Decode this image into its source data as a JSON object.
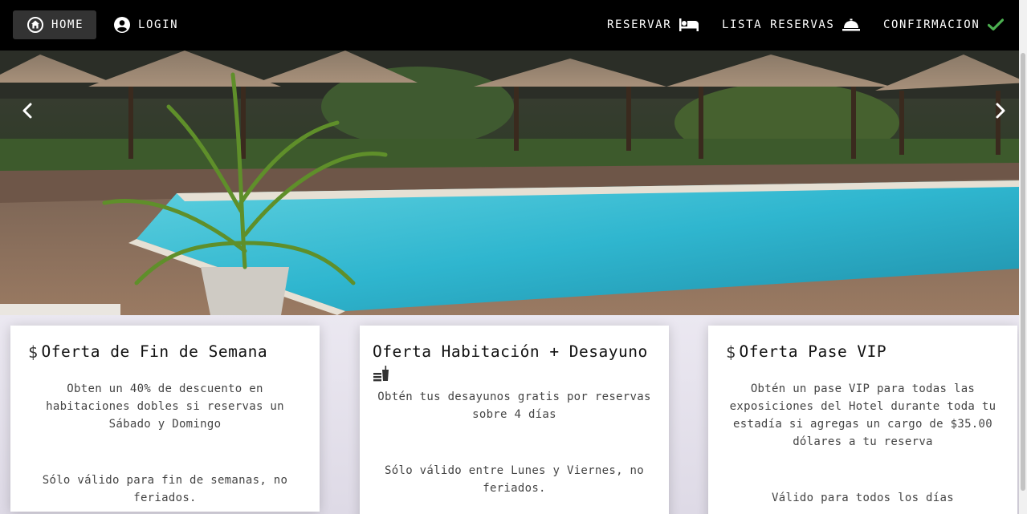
{
  "nav": {
    "home_label": "HOME",
    "login_label": "LOGIN",
    "reservar_label": "RESERVAR",
    "lista_reservas_label": "LISTA RESERVAS",
    "confirmacion_label": "CONFIRMACION",
    "icons": {
      "home": "home-icon",
      "login": "account-circle-icon",
      "reservar": "bed-icon",
      "lista_reservas": "room-service-bell-icon",
      "confirmacion": "checkmark-icon"
    },
    "colors": {
      "background": "#000000",
      "active": "#333333",
      "check": "#4caf50"
    }
  },
  "carousel": {
    "image_alt": "",
    "prev_icon": "chevron-left-icon",
    "next_icon": "chevron-right-icon"
  },
  "cards": [
    {
      "icon": "dollar-icon",
      "title": "Oferta de Fin de Semana",
      "description": "Obten un 40% de descuento en habitaciones dobles si reservas un Sábado y Domingo",
      "note": "Sólo válido para fin de semanas, no feriados."
    },
    {
      "icon": "breakfast-icon",
      "title": "Oferta Habitación + Desayuno",
      "description": "Obtén tus desayunos gratis por reservas sobre 4 días",
      "note": "Sólo válido entre Lunes y Viernes, no feriados."
    },
    {
      "icon": "dollar-icon",
      "title": "Oferta Pase VIP",
      "description": "Obtén un pase VIP para todas las exposiciones del Hotel durante toda tu estadía si agregas un cargo de $35.00 dólares a tu reserva",
      "note": "Válido para todos los días"
    }
  ]
}
